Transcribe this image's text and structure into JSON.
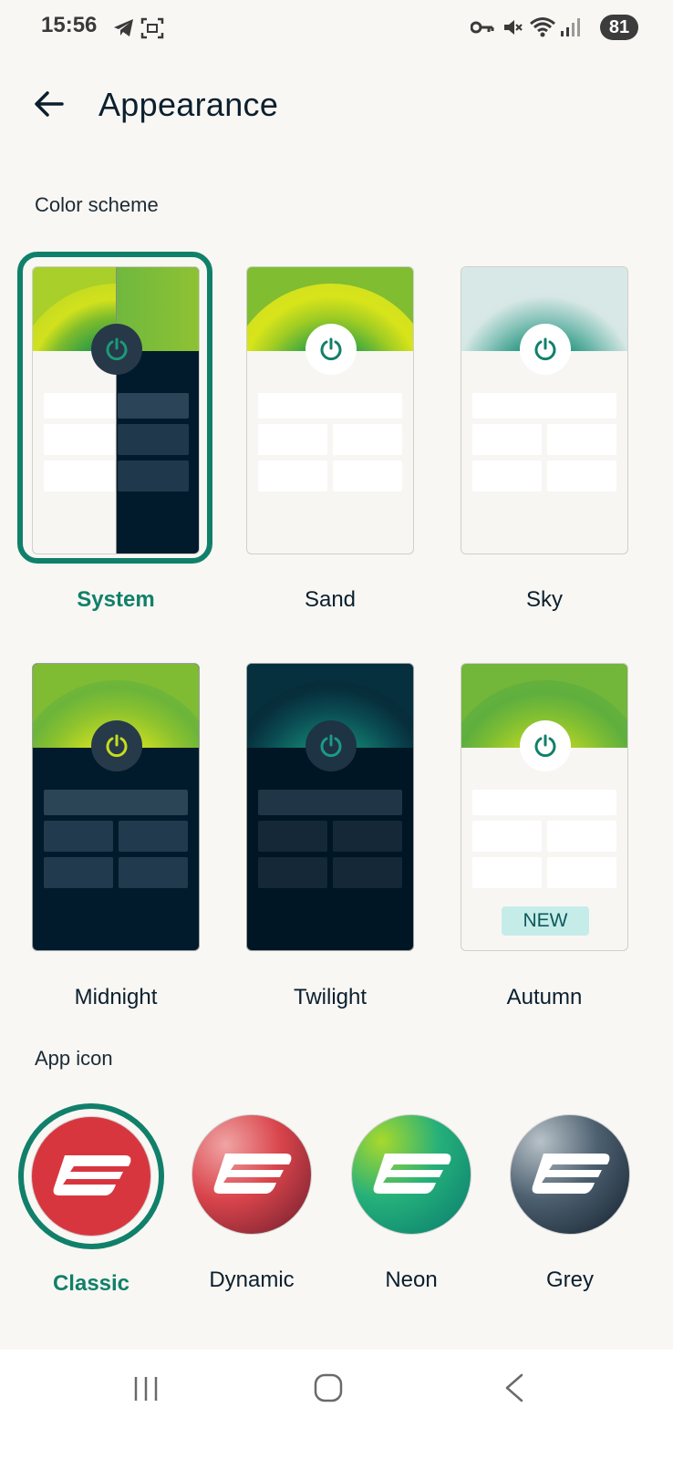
{
  "status_bar": {
    "time": "15:56",
    "battery": "81"
  },
  "header": {
    "title": "Appearance",
    "back_icon": "arrow-left-icon"
  },
  "color_scheme": {
    "heading": "Color scheme",
    "selected": "System",
    "options": [
      {
        "label": "System"
      },
      {
        "label": "Sand"
      },
      {
        "label": "Sky"
      },
      {
        "label": "Midnight"
      },
      {
        "label": "Twilight"
      },
      {
        "label": "Autumn",
        "badge": "NEW"
      }
    ]
  },
  "app_icon": {
    "heading": "App icon",
    "selected": "Classic",
    "options": [
      {
        "label": "Classic",
        "color": "#d8363f"
      },
      {
        "label": "Dynamic",
        "color": "#c4434a"
      },
      {
        "label": "Neon",
        "color": "#18a37c"
      },
      {
        "label": "Grey",
        "color": "#2c3e50"
      }
    ]
  },
  "colors": {
    "accent": "#11806a"
  },
  "nav": {
    "recents_icon": "recents-icon",
    "home_icon": "home-icon",
    "back_icon": "back-icon"
  }
}
